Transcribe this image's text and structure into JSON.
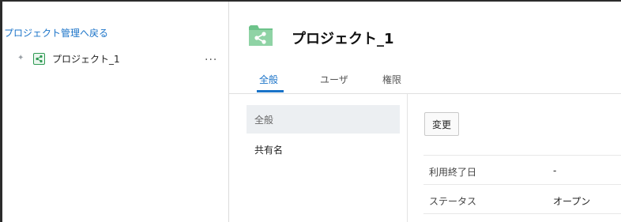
{
  "sidebar": {
    "back_link": "プロジェクト管理へ戻る",
    "tree": [
      {
        "label": "プロジェクト_1",
        "more": "..."
      }
    ]
  },
  "header": {
    "title": "プロジェクト_1",
    "icon": "share-network-icon"
  },
  "tabs": [
    {
      "label": "全般",
      "active": true
    },
    {
      "label": "ユーザ",
      "active": false
    },
    {
      "label": "権限",
      "active": false
    }
  ],
  "subnav": [
    {
      "label": "全般",
      "selected": true
    },
    {
      "label": "共有名",
      "selected": false
    }
  ],
  "content": {
    "change_button": "変更",
    "rows": [
      {
        "label": "利用終了日",
        "value": "-"
      },
      {
        "label": "ステータス",
        "value": "オープン"
      }
    ]
  },
  "colors": {
    "accent": "#1a73c8",
    "project_icon_green": "#2f9a53",
    "selected_bg": "#eceff2"
  }
}
